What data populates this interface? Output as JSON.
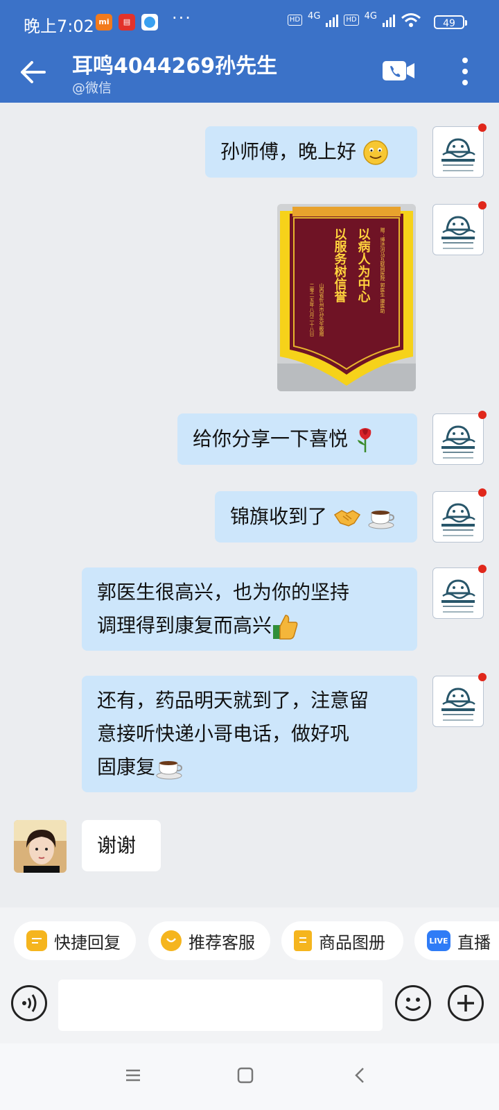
{
  "status_bar": {
    "time": "晚上7:02",
    "dots": "···",
    "network": "4G",
    "hd": "HD",
    "battery": "49"
  },
  "header": {
    "title": "耳鸣4044269孙先生",
    "subtitle": "@微信"
  },
  "messages": [
    {
      "text": "孙师傅，晚上好"
    },
    {
      "text": "给你分享一下喜悦"
    },
    {
      "text": "锦旗收到了"
    },
    {
      "lines": [
        "郭医生很高兴，也为你的坚持",
        "调理得到康复而高兴"
      ]
    },
    {
      "lines": [
        "还有，药品明天就到了，注意留",
        "意接听快递小哥电话，做好巩",
        "固康复"
      ]
    },
    {
      "text": "谢谢"
    }
  ],
  "banner": {
    "col1": "以病人为中心",
    "col2": "以服务树信誉",
    "dedication": "赠：博济河马互联网医院 郭医生 康医助",
    "signature": "山西省忻州市孙先生敬赠",
    "date": "二零二五年八月二十八日"
  },
  "quick_replies": [
    "快捷回复",
    "推荐客服",
    "商品图册",
    "直播"
  ],
  "quick_reply_live_badge": "LIVE",
  "colors": {
    "header": "#3b72c8",
    "bubble_out": "#cde6fb",
    "chip_icon": "#f5b51e",
    "live_badge": "#2f7cf6"
  }
}
